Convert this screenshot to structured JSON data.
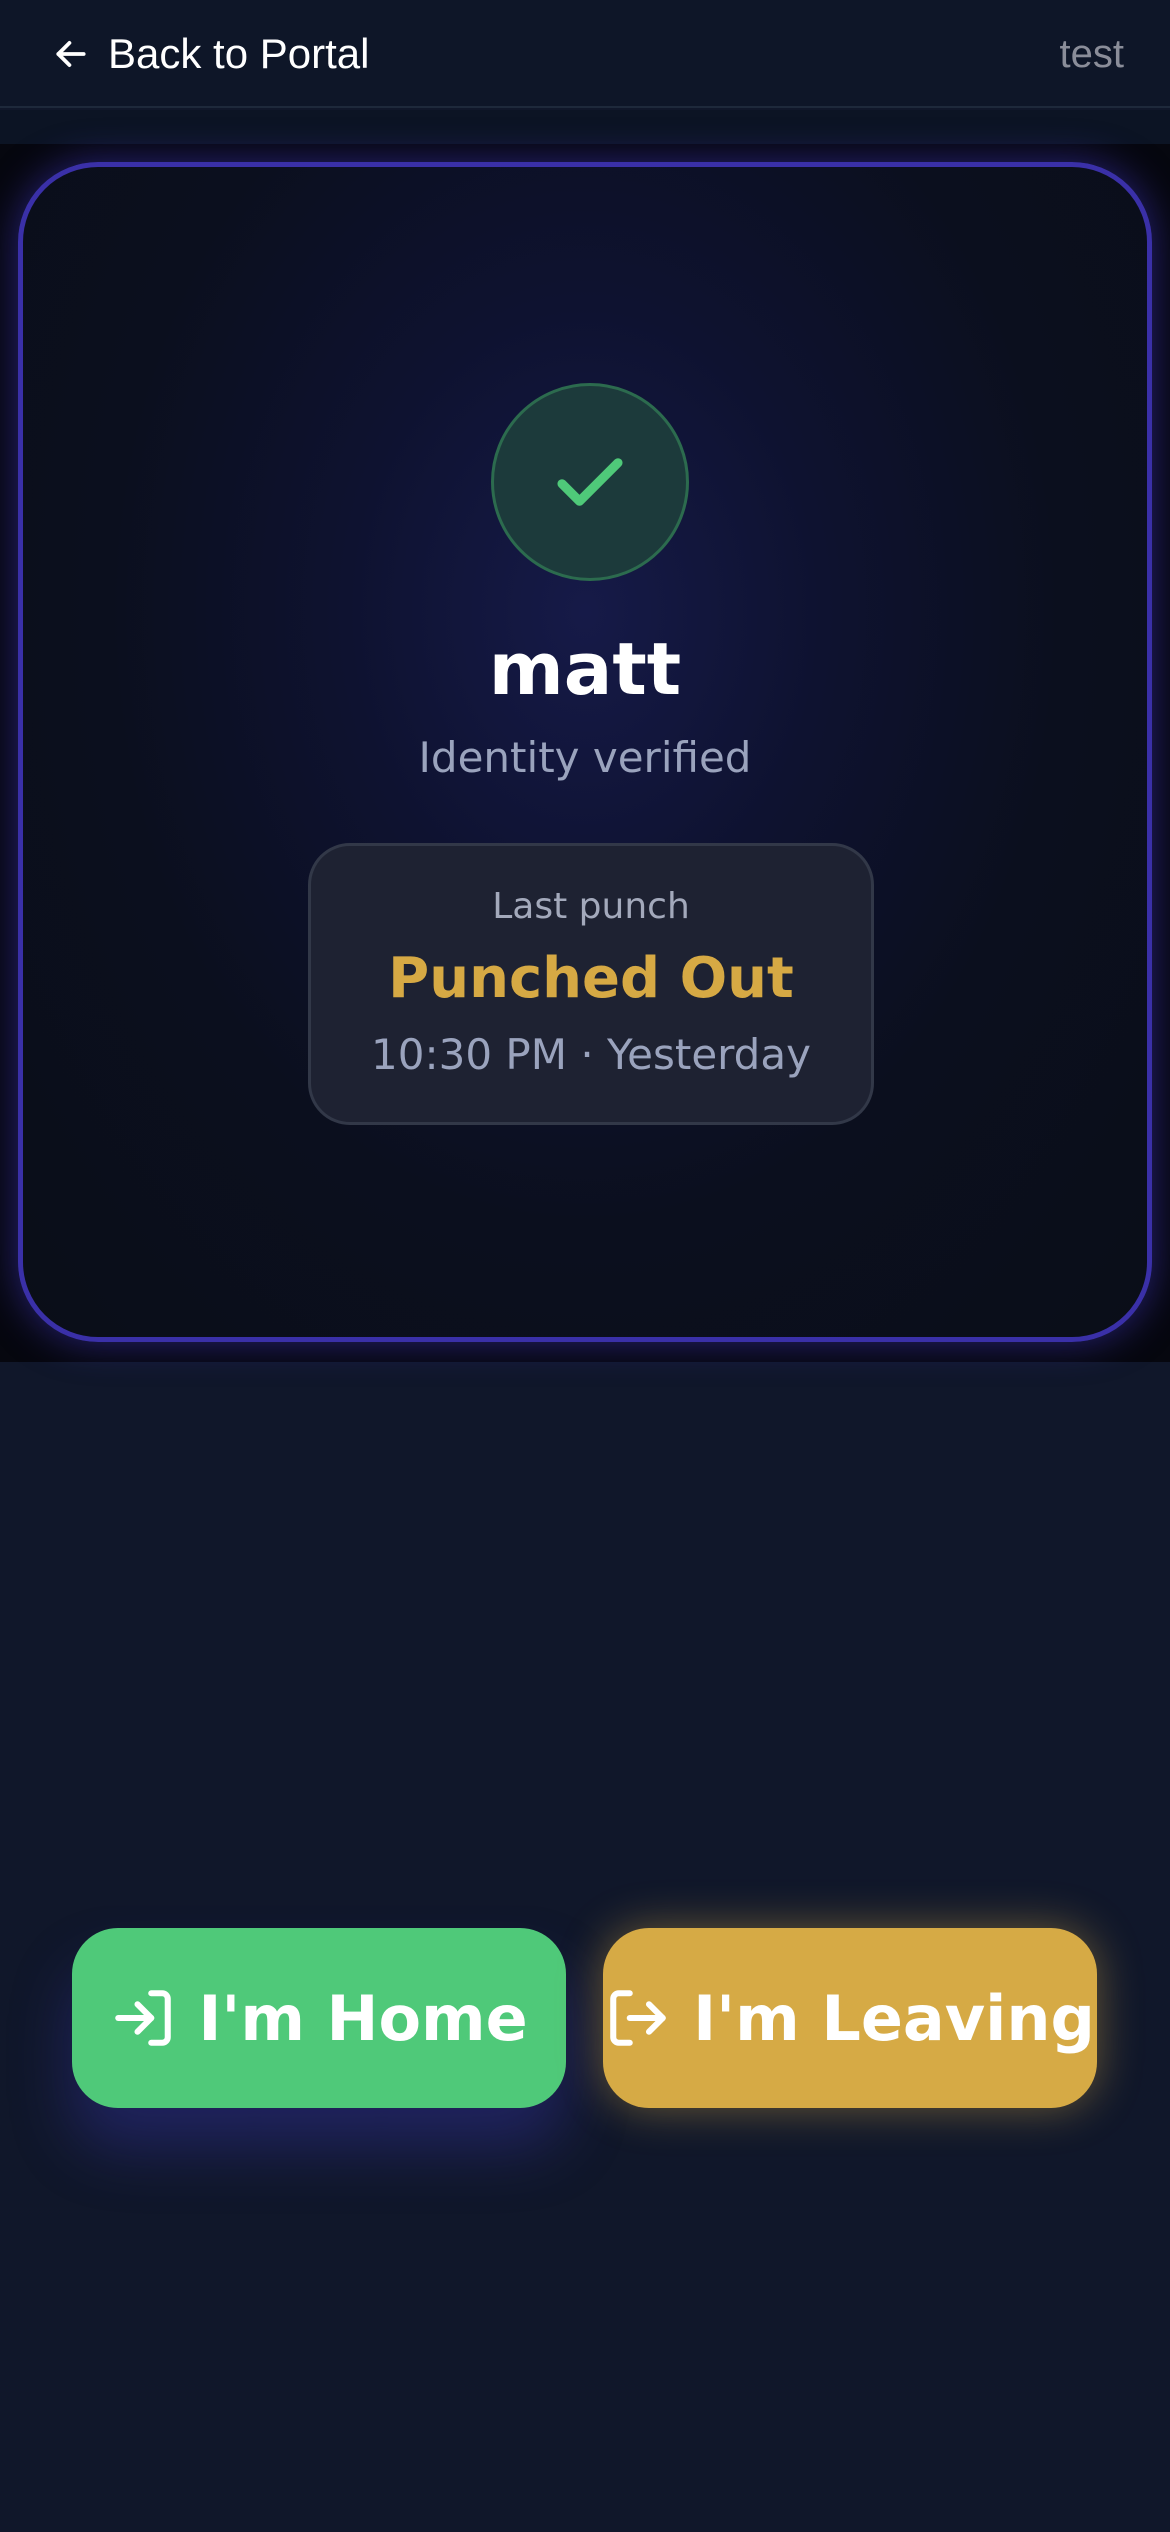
{
  "header": {
    "back_label": "Back to Portal",
    "user_label": "test",
    "back_icon": "arrow-left-icon"
  },
  "card": {
    "status_icon": "check-icon",
    "name": "matt",
    "verified_text": "Identity verified",
    "punch": {
      "label": "Last punch",
      "status": "Punched Out",
      "time": "10:30 PM · Yesterday"
    }
  },
  "actions": {
    "home_label": "I'm Home",
    "home_icon": "log-in-icon",
    "leave_label": "I'm Leaving",
    "leave_icon": "log-out-icon"
  },
  "colors": {
    "background": "#10172a",
    "card_border": "#3a30a8",
    "success": "#4fc979",
    "warning": "#d6aa45",
    "muted_text": "#9aa3bd"
  }
}
